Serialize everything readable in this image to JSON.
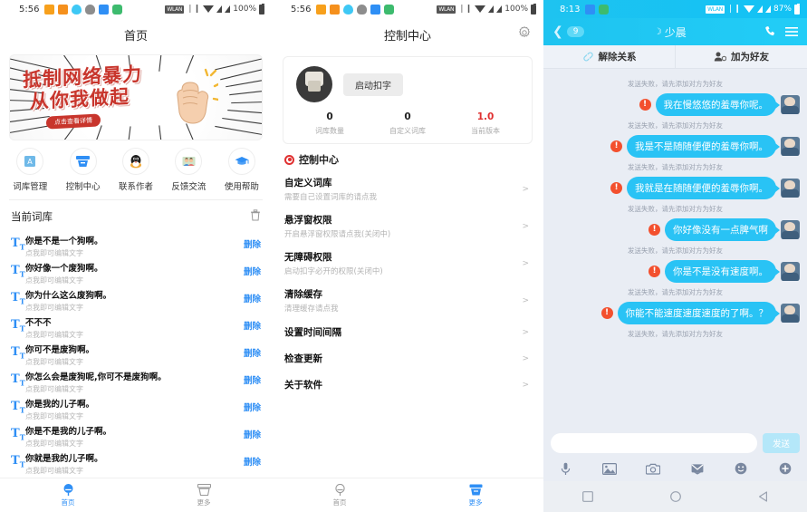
{
  "panel1": {
    "statusbar": {
      "time": "5:56",
      "battery": "100%",
      "wifi_label": "WLAN"
    },
    "title": "首页",
    "banner": {
      "line1": "抵制网络暴力",
      "line2": "从你我做起",
      "button": "点击查看详情"
    },
    "quick_icons": [
      {
        "label": "词库管理",
        "icon": "library-icon"
      },
      {
        "label": "控制中心",
        "icon": "control-center-icon"
      },
      {
        "label": "联系作者",
        "icon": "qq-penguin-icon"
      },
      {
        "label": "反馈交流",
        "icon": "feedback-people-icon"
      },
      {
        "label": "使用帮助",
        "icon": "graduation-cap-icon"
      }
    ],
    "lib_header": {
      "title": "当前词库",
      "trash": "trash-icon"
    },
    "word_sub": "点我即可编辑文字",
    "delete_label": "删除",
    "words": [
      "你是不是一个狗啊。",
      "你好像一个废狗啊。",
      "你为什么这么废狗啊。",
      "不不不",
      "你可不是废狗啊。",
      "你怎么会是废狗呢,你可不是废狗啊。",
      "你是我的儿子啊。",
      "你是不是我的儿子啊。",
      "你就是我的儿子啊。"
    ],
    "tabs": [
      {
        "label": "首页",
        "active": true
      },
      {
        "label": "更多",
        "active": false
      }
    ]
  },
  "panel2": {
    "statusbar": {
      "time": "5:56",
      "battery": "100%",
      "wifi_label": "WLAN"
    },
    "title": "控制中心",
    "gear": "gear-icon",
    "card": {
      "start_button": "启动扣字",
      "stats": [
        {
          "value": "0",
          "label": "词库数量",
          "color": "#222222"
        },
        {
          "value": "0",
          "label": "自定义词库",
          "color": "#222222"
        },
        {
          "value": "1.0",
          "label": "当前版本",
          "color": "#e03131"
        }
      ]
    },
    "section_title": "控制中心",
    "settings": [
      {
        "main": "自定义词库",
        "sub": "需要自己设置词库的请点我"
      },
      {
        "main": "悬浮窗权限",
        "sub": "开启悬浮窗权限请点我(关闭中)"
      },
      {
        "main": "无障碍权限",
        "sub": "启动扣字必开的权限(关闭中)"
      },
      {
        "main": "清除缓存",
        "sub": "清理缓存请点我"
      },
      {
        "main": "设置时间间隔",
        "sub": ""
      },
      {
        "main": "检查更新",
        "sub": ""
      },
      {
        "main": "关于软件",
        "sub": ""
      }
    ],
    "tabs": [
      {
        "label": "首页",
        "active": false
      },
      {
        "label": "更多",
        "active": true
      }
    ]
  },
  "panel3": {
    "statusbar": {
      "time": "8:13",
      "battery": "87%",
      "wifi_label": "WLAN"
    },
    "header": {
      "back_badge": "9",
      "title": "少晨",
      "phone_icon": "phone-icon",
      "menu_icon": "hamburger-menu-icon"
    },
    "actions": [
      {
        "label": "解除关系",
        "icon": "broken-link-icon"
      },
      {
        "label": "加为好友",
        "icon": "add-friend-icon"
      }
    ],
    "system_note": "发送失败，请先添加对方为好友",
    "messages": [
      "我在慢悠悠的羞辱你呢。",
      "我是不是随随便便的羞辱你啊。",
      "我就是在随随便便的羞辱你啊。",
      "你好像没有一点脾气啊",
      "你是不是没有速度啊。",
      "你能不能速度速度速度的了啊。？"
    ],
    "input": {
      "placeholder": "",
      "value": "",
      "send_label": "发送"
    },
    "tools": [
      "microphone-icon",
      "image-icon",
      "camera-icon",
      "envelope-icon",
      "emoji-icon",
      "plus-icon"
    ],
    "navbar": [
      "recents-square-icon",
      "home-circle-icon",
      "back-triangle-icon"
    ]
  },
  "colors": {
    "accent_blue": "#2f8ff5",
    "chat_cyan": "#29c3f5",
    "error_red": "#f3502e",
    "banner_red": "#c8352c"
  }
}
